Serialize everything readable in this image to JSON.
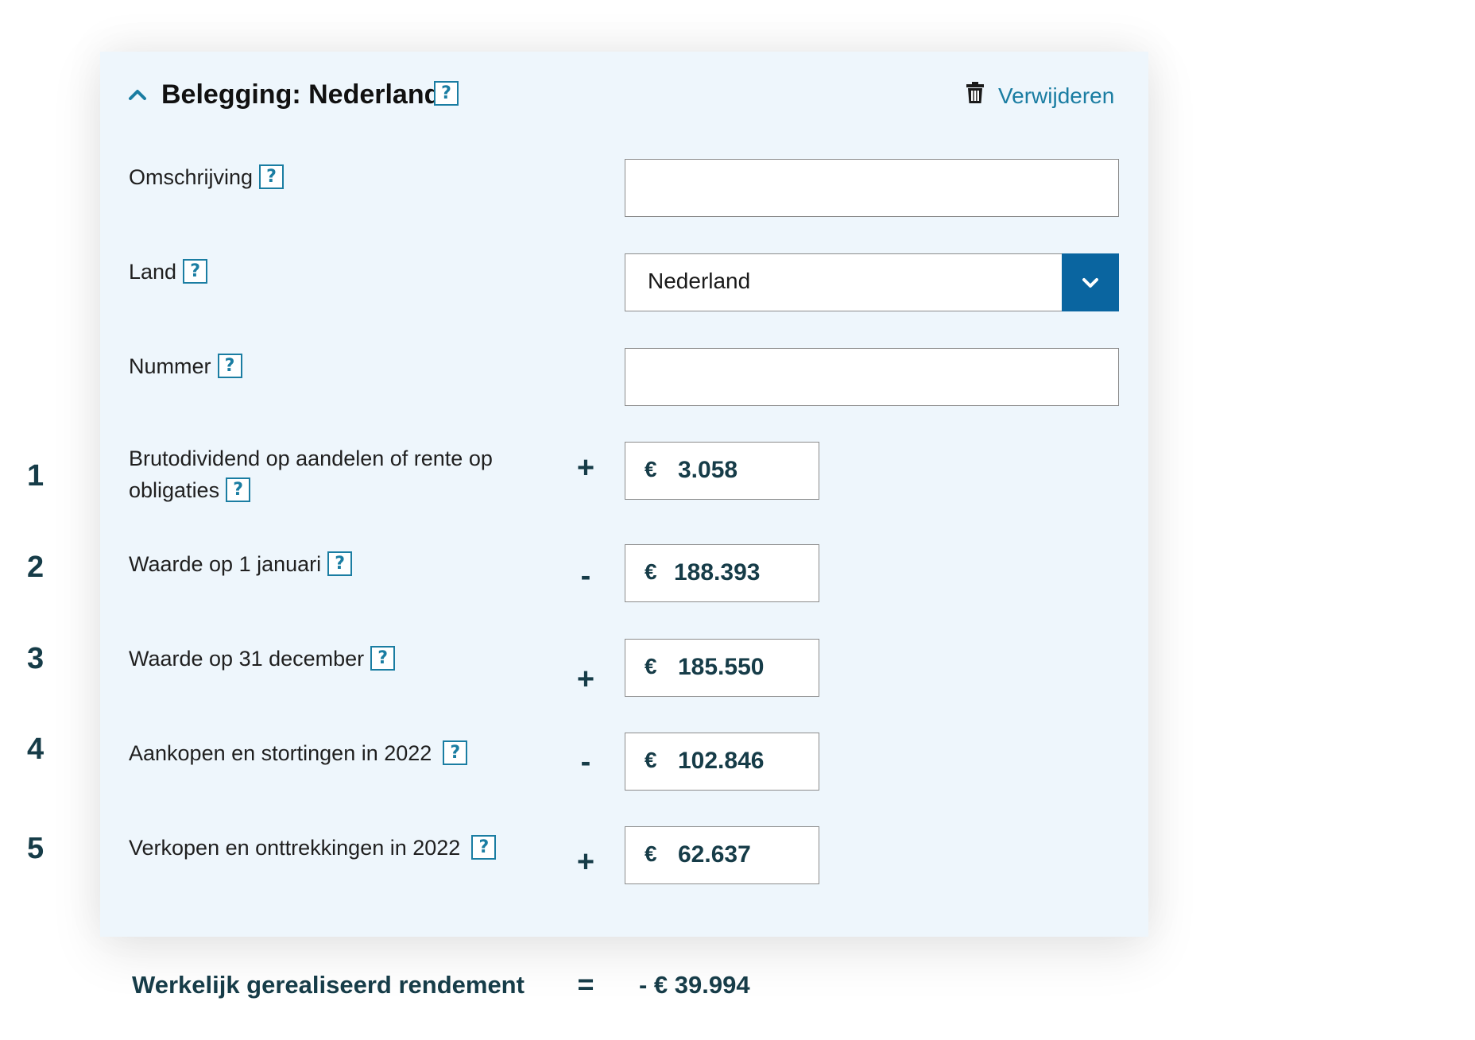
{
  "header": {
    "title": "Belegging: Nederland",
    "help_label": "?",
    "remove_label": "Verwijderen",
    "toggle_icon": "chevron-up-icon",
    "remove_icon": "trash-icon"
  },
  "fields": {
    "omschrijving": {
      "label": "Omschrijving",
      "help": "?",
      "value": ""
    },
    "land": {
      "label": "Land",
      "help": "?",
      "selected": "Nederland"
    },
    "nummer": {
      "label": "Nummer",
      "help": "?",
      "value": ""
    }
  },
  "rows": [
    {
      "num": "1",
      "label_line1": "Brutodividend op aandelen of rente op",
      "label_line2": "obligaties",
      "help": "?",
      "op": "+",
      "currency": "€",
      "value": "3.058"
    },
    {
      "num": "2",
      "label": "Waarde op 1 januari",
      "help": "?",
      "op": "-",
      "currency": "€",
      "value": "188.393"
    },
    {
      "num": "3",
      "label": "Waarde op 31 december",
      "help": "?",
      "op": "+",
      "currency": "€",
      "value": "185.550"
    },
    {
      "num": "4",
      "label": "Aankopen en stortingen in 2022",
      "help": "?",
      "op": "-",
      "currency": "€",
      "value": "102.846"
    },
    {
      "num": "5",
      "label": "Verkopen en onttrekkingen in 2022",
      "help": "?",
      "op": "+",
      "currency": "€",
      "value": "62.637"
    }
  ],
  "result": {
    "label": "Werkelijk gerealiseerd rendement",
    "op": "=",
    "value": "- € 39.994"
  },
  "colors": {
    "panel_bg": "#eef6fc",
    "accent": "#1a7da2",
    "select_button": "#0a65a0",
    "value_text": "#163c48"
  }
}
